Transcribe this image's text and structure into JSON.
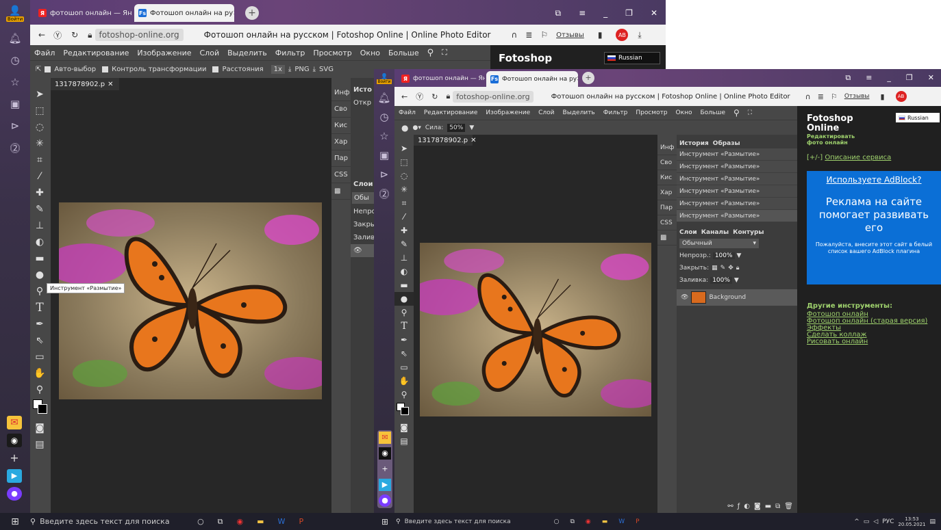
{
  "colors": {
    "accent": "#6a4478",
    "panel": "#474747",
    "canvas": "#272727",
    "adblock": "#0b6fd6",
    "link": "#9fd26d"
  },
  "yandex": {
    "login_label": "Войти"
  },
  "tabs": {
    "tab1": "фотошоп онлайн — Яндекс",
    "tab2": "Фотошоп онлайн на ру",
    "tab1_small": "фотошоп онлайн — Янде",
    "tab2_small": "Фотошоп онлайн на ру"
  },
  "address": {
    "domain": "fotoshop-online.org",
    "title": "Фотошоп онлайн на русском | Fotoshop Online | Online Photo Editor",
    "reviews": "Отзывы",
    "badge": "2"
  },
  "menu": [
    "Файл",
    "Редактирование",
    "Изображение",
    "Слой",
    "Выделить",
    "Фильтр",
    "Просмотр",
    "Окно",
    "Больше"
  ],
  "options_back": {
    "autoselect": "Авто-выбор",
    "transform": "Контроль трансформации",
    "distances": "Расстояния",
    "zoom": "1x",
    "png": "PNG",
    "svg": "SVG"
  },
  "options_front": {
    "strength_label": "Сила:",
    "strength_value": "50%"
  },
  "doc": {
    "filename_back": "1317878902.p",
    "filename_front": "1317878902.p"
  },
  "tooltip": "Инструмент «Размытие»",
  "mini_tabs": [
    "Инф",
    "Сво",
    "Кис",
    "Хар",
    "Пар",
    "CSS"
  ],
  "back_panel": {
    "history": "Исто",
    "open": "Откр",
    "layers": "Слои",
    "normal": "Обы",
    "opacity": "Непро",
    "lock": "Закры",
    "fill": "Залив"
  },
  "history": {
    "tab": "История",
    "tab2": "Образы",
    "items": [
      "Инструмент «Размытие»",
      "Инструмент «Размытие»",
      "Инструмент «Размытие»",
      "Инструмент «Размытие»",
      "Инструмент «Размытие»",
      "Инструмент «Размытие»"
    ]
  },
  "layers": {
    "tabs": [
      "Слои",
      "Каналы",
      "Контуры"
    ],
    "blend": "Обычный",
    "opacity_label": "Непрозр.:",
    "opacity_value": "100%",
    "lock_label": "Закрыть:",
    "fill_label": "Заливка:",
    "fill_value": "100%",
    "layer_name": "Background"
  },
  "site": {
    "brand": "Fotoshop",
    "brand2": "Online",
    "tagline": "Редактировать фото онлайн",
    "lang": "Russian",
    "toggle": "[+/-]",
    "about": "Описание сервиса",
    "ad_q": "Используете AdBlock?",
    "ad_h": "Реклама на сайте помогает развивать его",
    "ad_p": "Пожалуйста, внесите этот сайт в белый список вашего AdBlock плагина",
    "other": "Другие инструменты:",
    "links": [
      "Фотошоп онлайн",
      "Фотошоп онлайн (старая версия)",
      "Эффекты",
      "Сделать коллаж",
      "Рисовать онлайн"
    ]
  },
  "taskbar": {
    "search_back": "Введите здесь текст для поиска",
    "search_front": "Введите здесь текст для поиска",
    "lang": "РУС",
    "time": "13:53",
    "date": "20.05.2021"
  }
}
